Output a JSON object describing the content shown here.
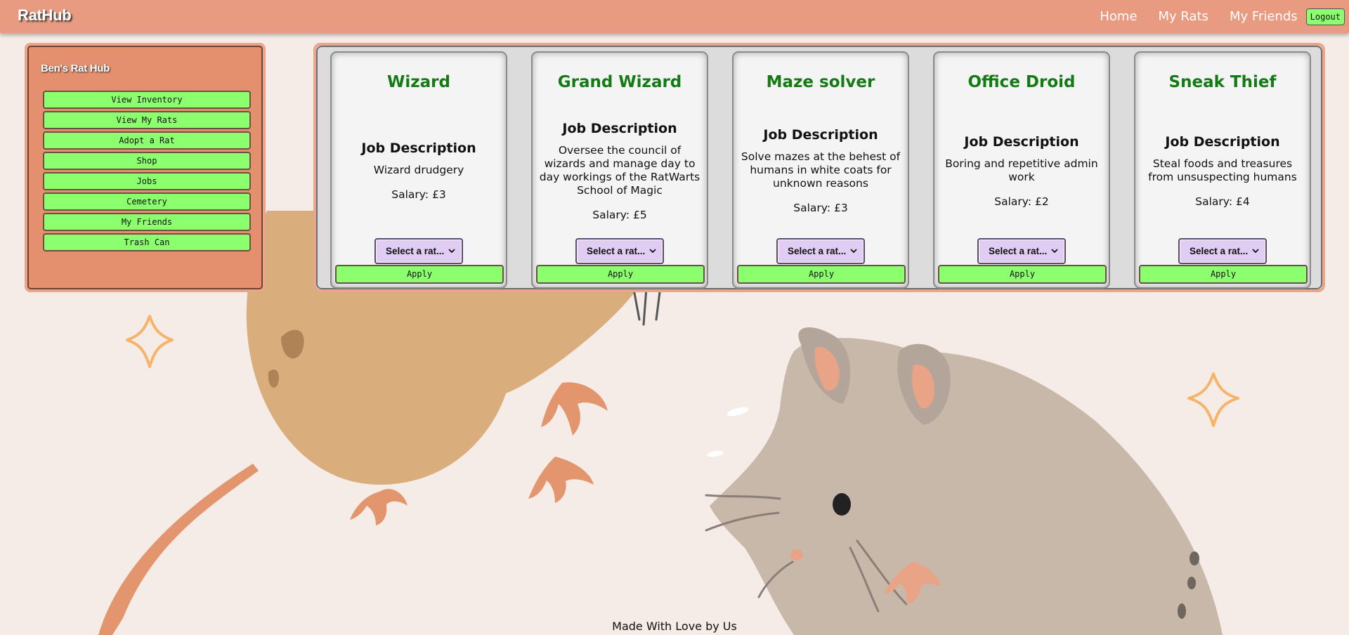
{
  "topbar": {
    "brand": "RatHub",
    "nav": [
      "Home",
      "My Rats",
      "My Friends"
    ],
    "logout_label": "Logout"
  },
  "sidebar": {
    "title": "Ben's Rat Hub",
    "items": [
      "View Inventory",
      "View My Rats",
      "Adopt a Rat",
      "Shop",
      "Jobs",
      "Cemetery",
      "My Friends",
      "Trash Can"
    ]
  },
  "jobs": [
    {
      "title": "Wizard",
      "desc_heading": "Job Description",
      "description": "Wizard drudgery",
      "salary": "Salary: £3",
      "select_placeholder": "Select a rat...",
      "apply_label": "Apply"
    },
    {
      "title": "Grand Wizard",
      "desc_heading": "Job Description",
      "description": "Oversee the council of wizards and manage day to day workings of the RatWarts School of Magic",
      "salary": "Salary: £5",
      "select_placeholder": "Select a rat...",
      "apply_label": "Apply"
    },
    {
      "title": "Maze solver",
      "desc_heading": "Job Description",
      "description": "Solve mazes at the behest of humans in white coats for unknown reasons",
      "salary": "Salary: £3",
      "select_placeholder": "Select a rat...",
      "apply_label": "Apply"
    },
    {
      "title": "Office Droid",
      "desc_heading": "Job Description",
      "description": "Boring and repetitive admin work",
      "salary": "Salary: £2",
      "select_placeholder": "Select a rat...",
      "apply_label": "Apply"
    },
    {
      "title": "Sneak Thief",
      "desc_heading": "Job Description",
      "description": "Steal foods and treasures from unsuspecting humans",
      "salary": "Salary: £4",
      "select_placeholder": "Select a rat...",
      "apply_label": "Apply"
    }
  ],
  "footer": {
    "text": "Made With Love by Us"
  },
  "colors": {
    "topbar": "#e89b80",
    "page_background": "#f5ebe7",
    "button_green": "#8cff6e",
    "job_title_green": "#137a14",
    "select_lavender": "#e1cdf4",
    "sidebar_panel": "#e48f6e"
  }
}
